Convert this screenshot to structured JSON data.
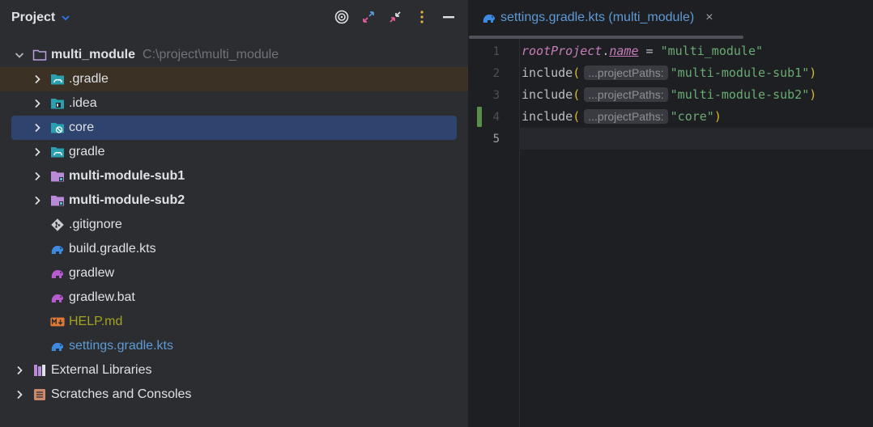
{
  "project_panel": {
    "title": "Project",
    "tools": [
      "locate-icon",
      "expand-icon",
      "collapse-icon",
      "more-icon",
      "minimize-icon"
    ],
    "tree": [
      {
        "label": "multi_module",
        "path": "C:\\project\\multi_module",
        "expanded": true
      },
      {
        "label": ".gradle"
      },
      {
        "label": ".idea"
      },
      {
        "label": "core",
        "selected": true
      },
      {
        "label": "gradle"
      },
      {
        "label": "multi-module-sub1"
      },
      {
        "label": "multi-module-sub2"
      },
      {
        "label": ".gitignore"
      },
      {
        "label": "build.gradle.kts"
      },
      {
        "label": "gradlew"
      },
      {
        "label": "gradlew.bat"
      },
      {
        "label": "HELP.md"
      },
      {
        "label": "settings.gradle.kts"
      },
      {
        "label": "External Libraries"
      },
      {
        "label": "Scratches and Consoles"
      }
    ]
  },
  "editor": {
    "tab": {
      "label": "settings.gradle.kts (multi_module)",
      "close": "×"
    },
    "line_numbers": [
      "1",
      "2",
      "3",
      "4",
      "5"
    ],
    "lines": [
      {
        "t1": "rootProject",
        "t2": ".",
        "t3": "name",
        "t4": " = ",
        "t5": "\"multi_module\""
      },
      {
        "fn": "include",
        "open": "(",
        "hint": "...projectPaths:",
        "str": "\"multi-module-sub1\"",
        "close": ")"
      },
      {
        "fn": "include",
        "open": "(",
        "hint": "...projectPaths:",
        "str": "\"multi-module-sub2\"",
        "close": ")"
      },
      {
        "fn": "include",
        "open": "(",
        "hint": "...projectPaths:",
        "str": "\"core\"",
        "close": ")"
      }
    ]
  },
  "colors": {
    "panel_bg": "#2b2d30",
    "editor_bg": "#1e1f22",
    "selection": "#2e436e",
    "string": "#6aab73",
    "keyword_purple": "#c77dbb",
    "link_blue": "#5e9ad6"
  }
}
